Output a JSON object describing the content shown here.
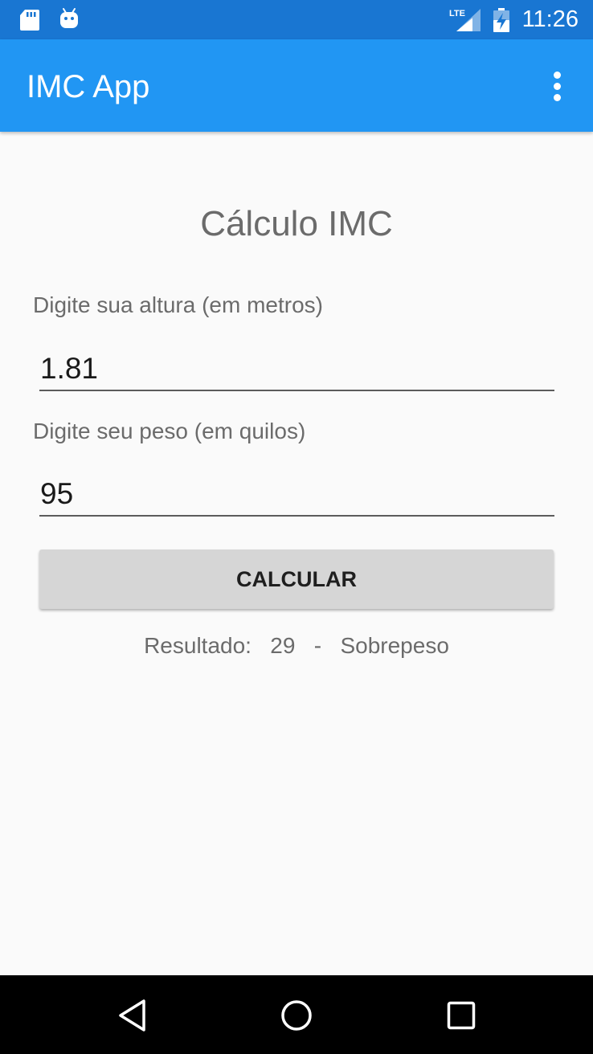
{
  "status_bar": {
    "time": "11:26",
    "network": "LTE",
    "icons": [
      "sd-card-icon",
      "android-debug-icon",
      "lte-signal-icon",
      "battery-charging-icon"
    ]
  },
  "app_bar": {
    "title": "IMC App",
    "menu_icon": "more-vert-icon"
  },
  "main": {
    "heading": "Cálculo IMC",
    "height_label": "Digite sua altura (em metros)",
    "height_value": "1.81",
    "weight_label": "Digite seu peso (em quilos)",
    "weight_value": "95",
    "button_label": "CALCULAR",
    "result": {
      "prefix": "Resultado:",
      "value": "29",
      "separator": "-",
      "classification": "Sobrepeso"
    }
  },
  "nav_bar": {
    "icons": [
      "back-icon",
      "home-icon",
      "recents-icon"
    ]
  },
  "colors": {
    "status_bar": "#1976d2",
    "app_bar": "#2196f3",
    "background": "#fafafa",
    "button": "#d6d6d6"
  }
}
